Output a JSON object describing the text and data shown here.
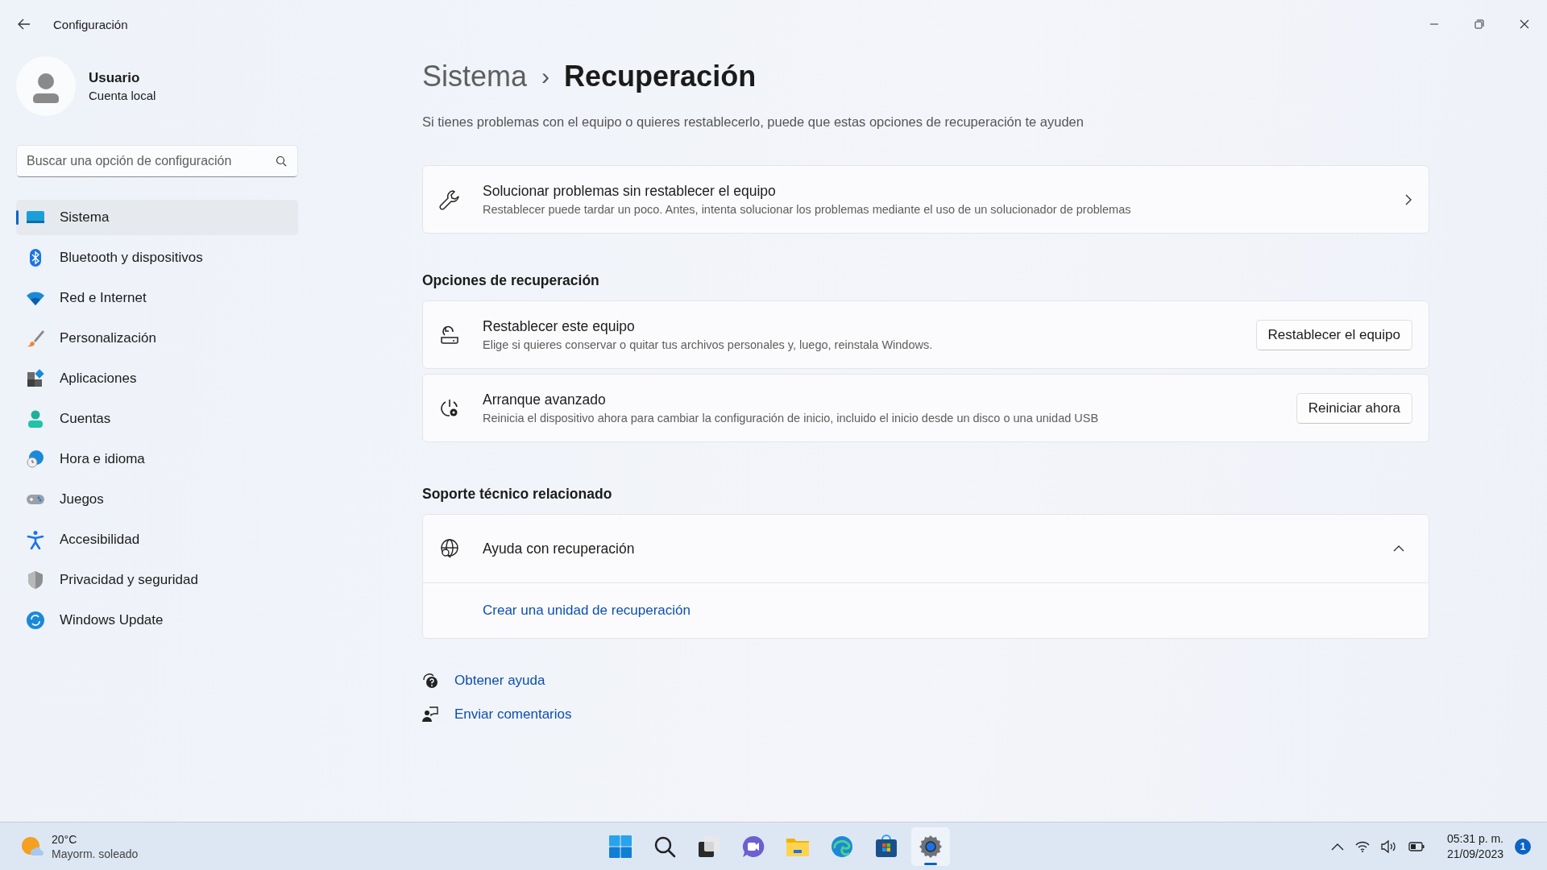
{
  "window": {
    "title": "Configuración"
  },
  "user": {
    "name": "Usuario",
    "account": "Cuenta local"
  },
  "search": {
    "placeholder": "Buscar una opción de configuración"
  },
  "nav": [
    {
      "label": "Sistema",
      "selected": true
    },
    {
      "label": "Bluetooth y dispositivos",
      "selected": false
    },
    {
      "label": "Red e Internet",
      "selected": false
    },
    {
      "label": "Personalización",
      "selected": false
    },
    {
      "label": "Aplicaciones",
      "selected": false
    },
    {
      "label": "Cuentas",
      "selected": false
    },
    {
      "label": "Hora e idioma",
      "selected": false
    },
    {
      "label": "Juegos",
      "selected": false
    },
    {
      "label": "Accesibilidad",
      "selected": false
    },
    {
      "label": "Privacidad y seguridad",
      "selected": false
    },
    {
      "label": "Windows Update",
      "selected": false
    }
  ],
  "breadcrumb": {
    "parent": "Sistema",
    "separator": "›",
    "current": "Recuperación"
  },
  "description": "Si tienes problemas con el equipo o quieres restablecerlo, puede que estas opciones de recuperación te ayuden",
  "troubleshoot": {
    "title": "Solucionar problemas sin restablecer el equipo",
    "subtitle": "Restablecer puede tardar un poco. Antes, intenta solucionar los problemas mediante el uso de un solucionador de problemas"
  },
  "recovery_options": {
    "heading": "Opciones de recuperación",
    "items": [
      {
        "title": "Restablecer este equipo",
        "subtitle": "Elige si quieres conservar o quitar tus archivos personales y, luego, reinstala Windows.",
        "button": "Restablecer el equipo"
      },
      {
        "title": "Arranque avanzado",
        "subtitle": "Reinicia el dispositivo ahora para cambiar la configuración de inicio, incluido el inicio desde un disco o una unidad USB",
        "button": "Reiniciar ahora"
      }
    ]
  },
  "support": {
    "heading": "Soporte técnico relacionado",
    "expander": {
      "title": "Ayuda con recuperación",
      "expanded": true,
      "links": [
        "Crear una unidad de recuperación"
      ]
    }
  },
  "footer_links": [
    "Obtener ayuda",
    "Enviar comentarios"
  ],
  "taskbar": {
    "weather": {
      "temperature": "20°C",
      "condition": "Mayorm. soleado"
    },
    "apps": [
      {
        "selected": false
      },
      {
        "selected": false
      },
      {
        "selected": false
      },
      {
        "selected": false
      },
      {
        "selected": false
      },
      {
        "selected": false
      },
      {
        "selected": false
      },
      {
        "selected": true
      }
    ],
    "clock": {
      "time": "05:31 p. m.",
      "date": "21/09/2023"
    },
    "notifications": "1"
  }
}
